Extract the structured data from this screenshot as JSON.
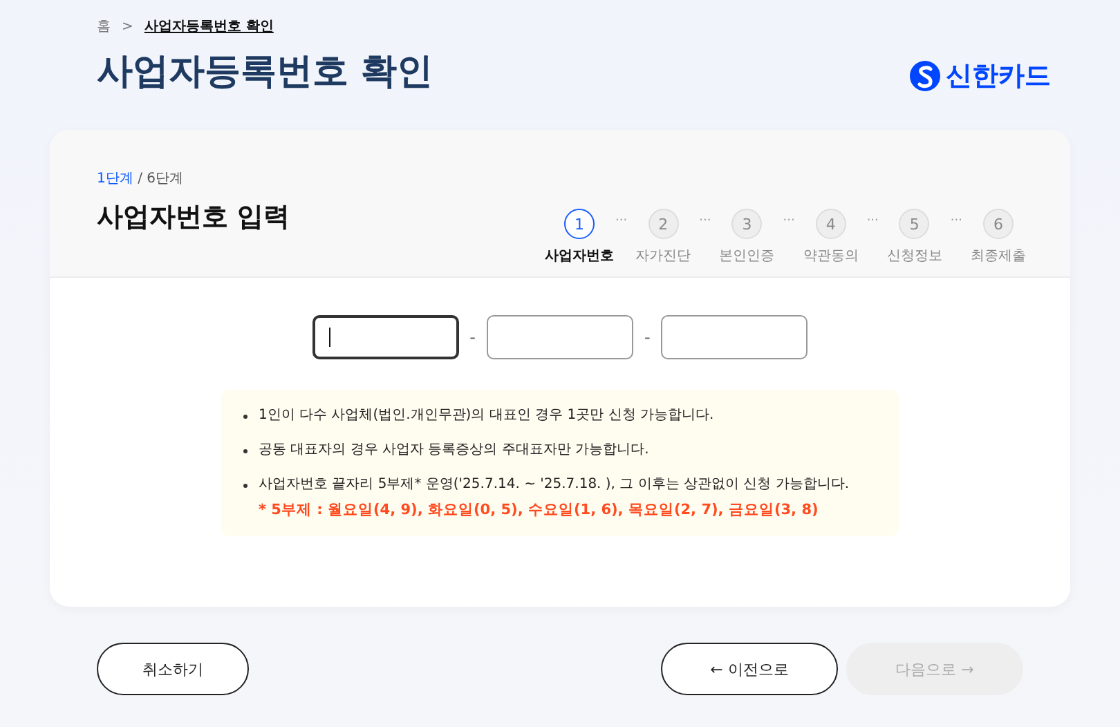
{
  "breadcrumb": {
    "home": "홈",
    "separator": ">",
    "current": "사업자등록번호 확인"
  },
  "page_title": "사업자등록번호 확인",
  "logo": {
    "text": "신한카드"
  },
  "step_progress": {
    "current": "1단계",
    "total": "/ 6단계"
  },
  "section_title": "사업자번호 입력",
  "steps": [
    {
      "number": "1",
      "label": "사업자번호",
      "selected": true
    },
    {
      "number": "2",
      "label": "자가진단",
      "selected": false
    },
    {
      "number": "3",
      "label": "본인인증",
      "selected": false
    },
    {
      "number": "4",
      "label": "약관동의",
      "selected": false
    },
    {
      "number": "5",
      "label": "신청정보",
      "selected": false
    },
    {
      "number": "6",
      "label": "최종제출",
      "selected": false
    }
  ],
  "step_separator": "···",
  "business_number_fields": [
    {
      "focused": true
    },
    {
      "focused": false
    },
    {
      "focused": false
    }
  ],
  "field_separator": "-",
  "notices": [
    {
      "text": "1인이 다수 사업체(법인.개인무관)의 대표인 경우 1곳만 신청 가능합니다."
    },
    {
      "text": "공동 대표자의 경우 사업자 등록증상의 주대표자만 가능합니다."
    },
    {
      "text": "사업자번호 끝자리 5부제* 운영('25.7.14. ~ '25.7.18. ), 그 이후는 상관없이 신청 가능합니다.",
      "note": "* 5부제 : 월요일(4, 9), 화요일(0, 5), 수요일(1, 6), 목요일(2, 7), 금요일(3, 8)"
    }
  ],
  "buttons": {
    "cancel": {
      "label": "취소하기"
    },
    "prev": {
      "label": "이전으로",
      "arrow": "←"
    },
    "next": {
      "label": "다음으로",
      "arrow": "→",
      "disabled": true
    }
  }
}
